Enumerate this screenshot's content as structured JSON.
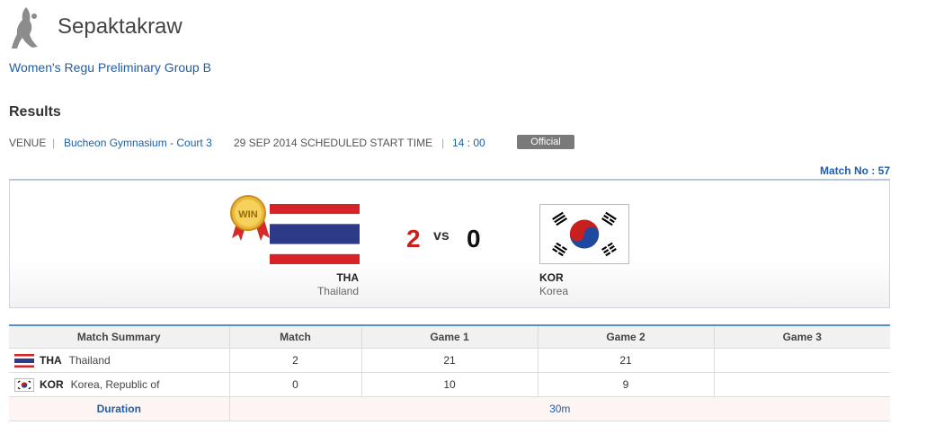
{
  "header": {
    "sport_icon": "sepaktakraw-player-icon",
    "sport_title": "Sepaktakraw",
    "event_title": "Women's Regu Preliminary Group B"
  },
  "results": {
    "heading": "Results",
    "venue_label": "VENUE",
    "venue_name": "Bucheon Gymnasium - Court 3",
    "date": "29 SEP 2014",
    "start_label": "SCHEDULED START TIME",
    "start_time": "14 : 00",
    "status_badge": "Official",
    "match_no_label": "Match No : ",
    "match_no": "57"
  },
  "scoreboard": {
    "win_badge": "WIN",
    "left": {
      "code": "THA",
      "name": "Thailand",
      "score": "2",
      "flag": "thailand-flag"
    },
    "vs": "vs",
    "right": {
      "code": "KOR",
      "name": "Korea",
      "score": "0",
      "flag": "korea-flag"
    }
  },
  "summary": {
    "headers": [
      "Match Summary",
      "Match",
      "Game 1",
      "Game 2",
      "Game 3"
    ],
    "rows": [
      {
        "code": "THA",
        "name": "Thailand",
        "match": "2",
        "game1": "21",
        "game2": "21",
        "game3": ""
      },
      {
        "code": "KOR",
        "name": "Korea, Republic of",
        "match": "0",
        "game1": "10",
        "game2": "9",
        "game3": ""
      }
    ],
    "duration_label": "Duration",
    "duration_value": "30m"
  },
  "colors": {
    "link": "#1f5ea8",
    "winner_score": "#c8201e",
    "table_top_border": "#5b8fc9",
    "official_badge": "#7a7a7a"
  }
}
